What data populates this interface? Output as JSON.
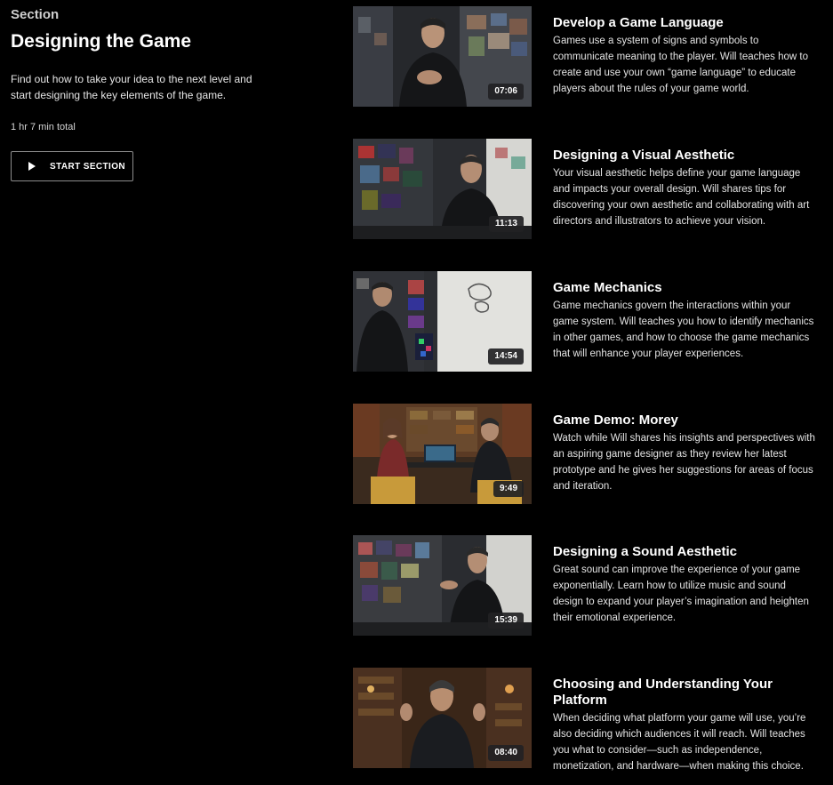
{
  "section": {
    "eyebrow": "Section",
    "title": "Designing the Game",
    "description": "Find out how to take your idea to the next level and start designing the key elements of the game.",
    "total": "1 hr 7 min total",
    "start_label": "START SECTION"
  },
  "lessons": [
    {
      "title": "Develop a Game Language",
      "description": "Games use a system of signs and symbols to communicate meaning to the player. Will teaches how to create and use your own “game language” to educate players about the rules of your game world.",
      "duration": "07:06"
    },
    {
      "title": "Designing a Visual Aesthetic",
      "description": "Your visual aesthetic helps define your game language and impacts your overall design. Will shares tips for discovering your own aesthetic and collaborating with art directors and illustrators to achieve your vision.",
      "duration": "11:13"
    },
    {
      "title": "Game Mechanics",
      "description": "Game mechanics govern the interactions within your game system. Will teaches you how to identify mechanics in other games, and how to choose the game mechanics that will enhance your player experiences.",
      "duration": "14:54"
    },
    {
      "title": "Game Demo: Morey",
      "description": "Watch while Will shares his insights and perspectives with an aspiring game designer as they review her latest prototype and he gives her suggestions for areas of focus and iteration.",
      "duration": "9:49"
    },
    {
      "title": "Designing a Sound Aesthetic",
      "description": "Great sound can improve the experience of your game exponentially. Learn how to utilize music and sound design to expand your player’s imagination and heighten their emotional experience.",
      "duration": "15:39"
    },
    {
      "title": "Choosing and Understanding Your Platform",
      "description": "When deciding what platform your game will use, you’re also deciding which audiences it will reach. Will teaches you what to consider—such as independence, monetization, and hardware—when making this choice.",
      "duration": "08:40"
    }
  ],
  "colors": {
    "background": "#000000",
    "text": "#ffffff",
    "button_border": "#8c8c8c",
    "duration_badge": "#222224"
  }
}
